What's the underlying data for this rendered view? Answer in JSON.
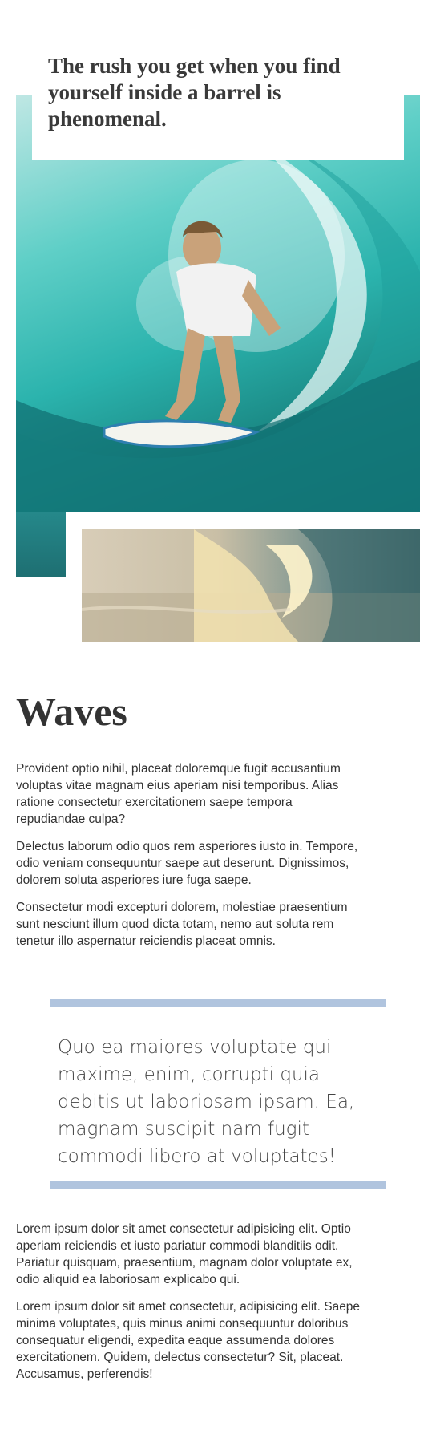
{
  "hero": {
    "headline": "The rush you get when you find yourself inside a barrel is phenomenal."
  },
  "article": {
    "title": "Waves",
    "paragraphs_top": [
      "Provident optio nihil, placeat doloremque fugit accusantium voluptas vitae magnam eius aperiam nisi temporibus. Alias ratione consectetur exercitationem saepe tempora repudiandae culpa?",
      "Delectus laborum odio quos rem asperiores iusto in. Tempore, odio veniam consequuntur saepe aut deserunt. Dignissimos, dolorem soluta asperiores iure fuga saepe.",
      "Consectetur modi excepturi dolorem, molestiae praesentium sunt nesciunt illum quod dicta totam, nemo aut soluta rem tenetur illo aspernatur reiciendis placeat omnis."
    ],
    "quote": "Quo ea maiores voluptate qui maxime, enim, corrupti quia debitis ut laboriosam ipsam. Ea, magnam suscipit nam fugit commodi libero at voluptates!",
    "paragraphs_bottom": [
      "Lorem ipsum dolor sit amet consectetur adipisicing elit. Optio aperiam reiciendis et iusto pariatur commodi blanditiis odit. Pariatur quisquam, praesentium, magnam dolor voluptate ex, odio aliquid ea laboriosam explicabo qui.",
      "Lorem ipsum dolor sit amet consectetur, adipisicing elit. Saepe minima voluptates, quis minus animi consequuntur doloribus consequatur eligendi, expedita eaque assumenda dolores exercitationem. Quidem, delectus consectetur? Sit, placeat. Accusamus, perferendis!"
    ]
  },
  "theme": {
    "quote_border": "#b0c4de",
    "text": "#333333"
  }
}
